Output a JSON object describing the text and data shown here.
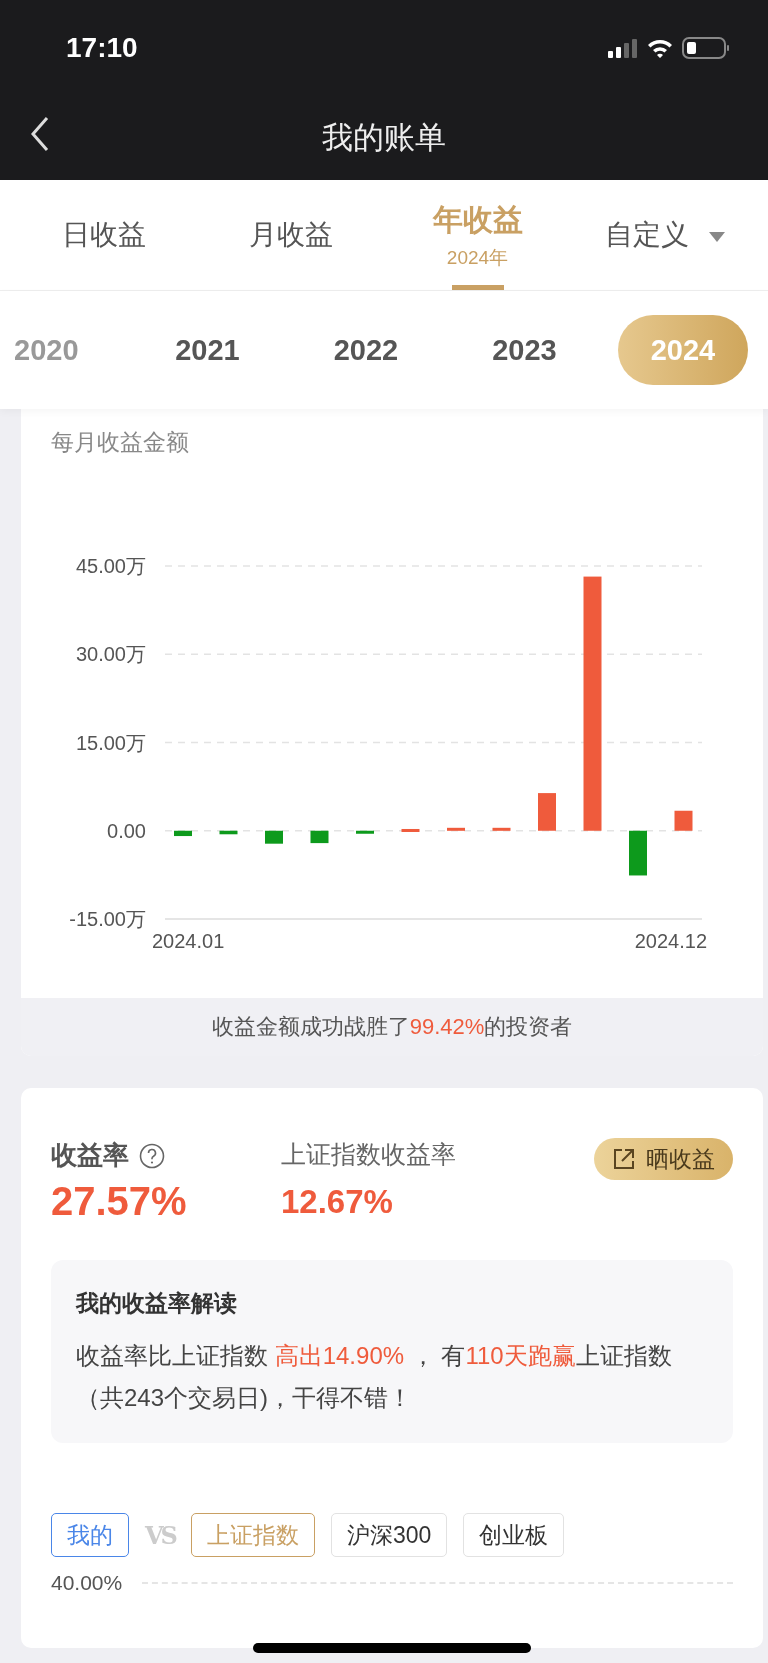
{
  "status_bar": {
    "time": "17:10"
  },
  "nav": {
    "title": "我的账单"
  },
  "tabs": [
    {
      "label": "日收益",
      "selected": false
    },
    {
      "label": "月收益",
      "selected": false
    },
    {
      "label": "年收益",
      "sub": "2024年",
      "selected": true
    },
    {
      "label": "自定义",
      "selected": false,
      "dropdown": true
    }
  ],
  "years": [
    {
      "label": "2020",
      "selected": false
    },
    {
      "label": "2021",
      "selected": false
    },
    {
      "label": "2022",
      "selected": false
    },
    {
      "label": "2023",
      "selected": false
    },
    {
      "label": "2024",
      "selected": true
    }
  ],
  "monthly_card": {
    "title": "每月收益金额",
    "chart_data": {
      "type": "bar",
      "categories": [
        "2024.01",
        null,
        null,
        null,
        null,
        null,
        null,
        null,
        null,
        null,
        null,
        "2024.12"
      ],
      "ylim": [
        -15,
        45
      ],
      "grid": true,
      "yticks": [
        {
          "value": 45,
          "label": "45.00万"
        },
        {
          "value": 30,
          "label": "30.00万"
        },
        {
          "value": 15,
          "label": "15.00万"
        },
        {
          "value": 0,
          "label": "0.00"
        },
        {
          "value": -15,
          "label": "-15.00万"
        }
      ],
      "series": [
        {
          "color": "#ef5b3c",
          "values": [
            null,
            null,
            null,
            null,
            null,
            0.3,
            0.5,
            0.5,
            6.4,
            43.2,
            null,
            3.4
          ]
        },
        {
          "color": "#0d9a1c",
          "values": [
            -0.9,
            -0.6,
            -2.2,
            -2.1,
            -0.3,
            null,
            null,
            null,
            null,
            null,
            -7.6,
            null
          ]
        }
      ]
    },
    "footer": [
      {
        "text": "收益金额成功战胜了",
        "highlight": false
      },
      {
        "text": "99.42%",
        "highlight": true
      },
      {
        "text": "的投资者",
        "highlight": false
      }
    ]
  },
  "rate_card": {
    "my_label": "收益率",
    "my_value": "27.57%",
    "index_label": "上证指数收益率",
    "index_value": "12.67%",
    "share_button": "晒收益",
    "interpretation": {
      "title": "我的收益率解读",
      "parts": [
        {
          "text": "收益率比上证指数 ",
          "highlight": false
        },
        {
          "text": "高出14.90%",
          "highlight": true
        },
        {
          "text": " ，  有",
          "highlight": false
        },
        {
          "text": "110天跑赢",
          "highlight": true
        },
        {
          "text": "上证指数（共243个交易日)，干得不错！",
          "highlight": false
        }
      ]
    },
    "compare": {
      "mine": {
        "label": "我的",
        "color": "#4a86e8"
      },
      "vs": "VS",
      "tags": [
        {
          "label": "上证指数",
          "color": "#c9a063"
        },
        {
          "label": "沪深300",
          "color": "#333333"
        },
        {
          "label": "创业板",
          "color": "#333333"
        }
      ]
    },
    "chart_tick": "40.00%"
  }
}
